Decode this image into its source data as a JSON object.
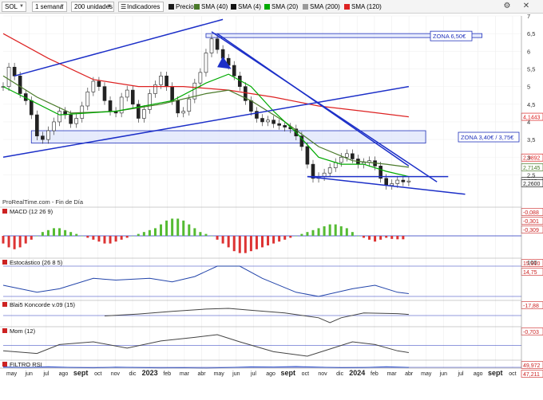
{
  "toolbar": {
    "symbol": "SOL",
    "timeframe": "1 semana",
    "units": "200 unidades",
    "indicators_label": "Indicadores",
    "legend": [
      {
        "label": "Precio",
        "color": "#1a1a1a"
      },
      {
        "label": "SMA (40)",
        "color": "#4a7a2a"
      },
      {
        "label": "SMA (4)",
        "color": "#111111"
      },
      {
        "label": "SMA (20)",
        "color": "#00aa00"
      },
      {
        "label": "SMA (200)",
        "color": "#9a9a9a"
      },
      {
        "label": "SMA (120)",
        "color": "#dd2222"
      }
    ]
  },
  "chart_data": [
    {
      "type": "line",
      "panel": "price",
      "source_note": "ProRealTime.com - Fin de Día",
      "ylim": [
        1.9,
        7
      ],
      "y_ticks": [
        "7",
        "6,5",
        "6",
        "5,5",
        "5",
        "4,5",
        "4",
        "3,5",
        "3",
        "2,5"
      ],
      "x_ticks": [
        "may",
        "jun",
        "jul",
        "ago",
        "sept",
        "oct",
        "nov",
        "dic",
        "2023",
        "feb",
        "mar",
        "abr",
        "may",
        "jun",
        "jul",
        "ago",
        "sept",
        "oct",
        "nov",
        "dic",
        "2024",
        "feb",
        "mar",
        "abr",
        "may",
        "jun",
        "jul",
        "ago",
        "sept",
        "oct"
      ],
      "price_series": [
        [
          0,
          5.0
        ],
        [
          1,
          5.55
        ],
        [
          2,
          5.3
        ],
        [
          3,
          4.8
        ],
        [
          4,
          4.6
        ],
        [
          5,
          4.2
        ],
        [
          6,
          3.6
        ],
        [
          7,
          3.5
        ],
        [
          8,
          3.75
        ],
        [
          9,
          4.0
        ],
        [
          10,
          4.3
        ],
        [
          11,
          4.2
        ],
        [
          12,
          3.95
        ],
        [
          13,
          4.1
        ],
        [
          14,
          4.45
        ],
        [
          15,
          4.85
        ],
        [
          16,
          5.15
        ],
        [
          17,
          5.0
        ],
        [
          18,
          4.6
        ],
        [
          19,
          4.3
        ],
        [
          20,
          4.25
        ],
        [
          21,
          4.7
        ],
        [
          22,
          4.9
        ],
        [
          23,
          4.5
        ],
        [
          24,
          4.1
        ],
        [
          25,
          4.35
        ],
        [
          26,
          4.8
        ],
        [
          27,
          5.05
        ],
        [
          28,
          5.3
        ],
        [
          29,
          5.0
        ],
        [
          30,
          4.6
        ],
        [
          31,
          4.25
        ],
        [
          32,
          4.3
        ],
        [
          33,
          4.65
        ],
        [
          34,
          5.1
        ],
        [
          35,
          5.4
        ],
        [
          36,
          5.95
        ],
        [
          37,
          6.35
        ],
        [
          38,
          6.05
        ],
        [
          39,
          5.8
        ],
        [
          40,
          5.6
        ],
        [
          41,
          5.3
        ],
        [
          42,
          5.0
        ],
        [
          43,
          4.6
        ],
        [
          44,
          4.3
        ],
        [
          45,
          4.1
        ],
        [
          46,
          4.0
        ],
        [
          47,
          4.05
        ],
        [
          48,
          3.95
        ],
        [
          49,
          3.9
        ],
        [
          50,
          3.85
        ],
        [
          51,
          3.8
        ],
        [
          52,
          3.6
        ],
        [
          53,
          3.3
        ],
        [
          54,
          2.8
        ],
        [
          55,
          2.4
        ],
        [
          56,
          2.45
        ],
        [
          57,
          2.55
        ],
        [
          58,
          2.7
        ],
        [
          59,
          2.85
        ],
        [
          60,
          3.0
        ],
        [
          61,
          3.1
        ],
        [
          62,
          2.95
        ],
        [
          63,
          2.8
        ],
        [
          64,
          2.85
        ],
        [
          65,
          2.9
        ],
        [
          66,
          2.75
        ],
        [
          67,
          2.4
        ],
        [
          68,
          2.2
        ],
        [
          69,
          2.25
        ],
        [
          70,
          2.35
        ],
        [
          71,
          2.3
        ],
        [
          72,
          2.325
        ]
      ],
      "sma_20": [
        [
          0,
          5.0
        ],
        [
          10,
          4.2
        ],
        [
          20,
          4.3
        ],
        [
          30,
          4.6
        ],
        [
          36,
          5.1
        ],
        [
          40,
          5.35
        ],
        [
          44,
          5.0
        ],
        [
          48,
          4.3
        ],
        [
          52,
          3.7
        ],
        [
          56,
          3.0
        ],
        [
          60,
          2.8
        ],
        [
          64,
          2.8
        ],
        [
          68,
          2.6
        ],
        [
          72,
          2.45
        ]
      ],
      "sma_40": [
        [
          0,
          5.3
        ],
        [
          6,
          4.7
        ],
        [
          12,
          4.25
        ],
        [
          20,
          4.3
        ],
        [
          28,
          4.5
        ],
        [
          36,
          4.8
        ],
        [
          40,
          4.9
        ],
        [
          44,
          4.6
        ],
        [
          50,
          4.0
        ],
        [
          56,
          3.3
        ],
        [
          62,
          2.9
        ],
        [
          68,
          2.8
        ],
        [
          72,
          2.714
        ]
      ],
      "sma_120": [
        [
          0,
          6.5
        ],
        [
          8,
          5.8
        ],
        [
          16,
          5.2
        ],
        [
          24,
          5.0
        ],
        [
          32,
          5.0
        ],
        [
          40,
          4.9
        ],
        [
          48,
          4.7
        ],
        [
          56,
          4.45
        ],
        [
          64,
          4.3
        ],
        [
          72,
          4.144
        ]
      ],
      "trendlines": [
        {
          "name": "upper-wedge-top",
          "points": [
            [
              2,
              5.3
            ],
            [
              39,
              6.9
            ]
          ]
        },
        {
          "name": "lower-channel",
          "points": [
            [
              0,
              3.0
            ],
            [
              72,
              5.0
            ]
          ]
        },
        {
          "name": "falling-resistance-1",
          "points": [
            [
              37,
              6.55
            ],
            [
              77,
              2.3
            ]
          ]
        },
        {
          "name": "falling-resistance-2",
          "points": [
            [
              38,
              6.5
            ],
            [
              72,
              2.75
            ]
          ]
        },
        {
          "name": "falling-support",
          "points": [
            [
              54,
              2.45
            ],
            [
              82,
              1.95
            ]
          ]
        },
        {
          "name": "horizontal-level",
          "points": [
            [
              54,
              2.45
            ],
            [
              79,
              2.45
            ]
          ]
        }
      ],
      "zones": [
        {
          "label": "ZONA 6,50€",
          "y": [
            6.39,
            6.5
          ],
          "x": [
            36,
            85
          ]
        },
        {
          "label": "ZONA 3,40€ / 3,75€",
          "y": [
            3.4,
            3.75
          ],
          "x": [
            5,
            75
          ]
        }
      ],
      "price_labels": [
        {
          "text": "4,1443",
          "value": 4.144,
          "color": "#dd2222"
        },
        {
          "text": "2,9892",
          "value": 2.989,
          "color": "#dd2222"
        },
        {
          "text": "2,7145",
          "value": 2.714,
          "color": "#4a7a2a"
        },
        {
          "text": "2,325",
          "value": 2.325,
          "color": "#1a1a1a"
        },
        {
          "text": "2,2600",
          "value": 2.26,
          "color": "#1a1a1a"
        }
      ]
    },
    {
      "type": "bar",
      "panel": "macd",
      "title": "MACD (12 26 9)",
      "value_labels": [
        "-0,088",
        "-0,301",
        "-0,309"
      ],
      "histogram": [
        -0.2,
        -0.3,
        -0.35,
        -0.3,
        -0.2,
        -0.1,
        0,
        0.1,
        0.15,
        0.2,
        0.2,
        0.15,
        0.1,
        0.05,
        0,
        -0.05,
        -0.1,
        -0.15,
        -0.2,
        -0.2,
        -0.15,
        -0.1,
        -0.05,
        0,
        0.05,
        0.1,
        0.15,
        0.2,
        0.3,
        0.4,
        0.45,
        0.45,
        0.4,
        0.3,
        0.2,
        0.1,
        0.05,
        0,
        -0.1,
        -0.2,
        -0.3,
        -0.4,
        -0.45,
        -0.45,
        -0.4,
        -0.35,
        -0.3,
        -0.25,
        -0.2,
        -0.15,
        -0.1,
        -0.05,
        0,
        0.05,
        0.1,
        0.15,
        0.2,
        0.25,
        0.3,
        0.3,
        0.25,
        0.2,
        0.1,
        0,
        -0.05,
        -0.1,
        -0.15,
        -0.1,
        -0.05,
        -0.08,
        -0.09,
        -0.09
      ]
    },
    {
      "type": "line",
      "panel": "stochastic",
      "title": "Estocástico (26 8 5)",
      "y_ticks": [
        "100"
      ],
      "value_labels": [
        "15,910",
        "14,75"
      ],
      "series": [
        {
          "values": [
            [
              0,
              40
            ],
            [
              6,
              20
            ],
            [
              10,
              30
            ],
            [
              16,
              60
            ],
            [
              20,
              55
            ],
            [
              26,
              60
            ],
            [
              30,
              50
            ],
            [
              34,
              65
            ],
            [
              38,
              95
            ],
            [
              42,
              95
            ],
            [
              46,
              60
            ],
            [
              52,
              20
            ],
            [
              56,
              8
            ],
            [
              62,
              30
            ],
            [
              66,
              40
            ],
            [
              70,
              20
            ],
            [
              72,
              16
            ]
          ]
        }
      ]
    },
    {
      "type": "area",
      "panel": "koncorde",
      "title": "Blai5 Koncorde v.09 (15)",
      "value_labels": [
        "-17,88"
      ],
      "series": [
        {
          "values": [
            [
              18,
              0
            ],
            [
              24,
              5
            ],
            [
              30,
              12
            ],
            [
              36,
              18
            ],
            [
              40,
              20
            ],
            [
              44,
              15
            ],
            [
              50,
              8
            ],
            [
              56,
              -5
            ],
            [
              58,
              -18
            ],
            [
              60,
              -5
            ],
            [
              64,
              8
            ],
            [
              70,
              6
            ],
            [
              72,
              4
            ]
          ]
        }
      ]
    },
    {
      "type": "area",
      "panel": "momentum",
      "title": "Mom (12)",
      "value_labels": [
        "-0,703"
      ],
      "series": [
        {
          "values": [
            [
              0,
              -0.5
            ],
            [
              6,
              -0.8
            ],
            [
              10,
              0.2
            ],
            [
              16,
              0.5
            ],
            [
              22,
              -0.2
            ],
            [
              28,
              0.6
            ],
            [
              34,
              1.0
            ],
            [
              38,
              1.3
            ],
            [
              42,
              0.5
            ],
            [
              48,
              -0.6
            ],
            [
              54,
              -1.1
            ],
            [
              58,
              -0.3
            ],
            [
              62,
              0.5
            ],
            [
              66,
              0.2
            ],
            [
              70,
              -0.5
            ],
            [
              72,
              -0.7
            ]
          ]
        }
      ]
    },
    {
      "type": "area",
      "panel": "rsi",
      "title": "FILTRO RSI",
      "value_labels": [
        "49,972",
        "47,211"
      ],
      "series": [
        {
          "values": [
            [
              0,
              40
            ],
            [
              4,
              55
            ],
            [
              8,
              35
            ],
            [
              12,
              50
            ],
            [
              16,
              60
            ],
            [
              20,
              45
            ],
            [
              24,
              55
            ],
            [
              28,
              62
            ],
            [
              32,
              58
            ],
            [
              36,
              68
            ],
            [
              40,
              52
            ],
            [
              44,
              38
            ],
            [
              48,
              42
            ],
            [
              52,
              30
            ],
            [
              56,
              45
            ],
            [
              60,
              58
            ],
            [
              64,
              52
            ],
            [
              68,
              35
            ],
            [
              72,
              50
            ]
          ]
        }
      ]
    }
  ]
}
